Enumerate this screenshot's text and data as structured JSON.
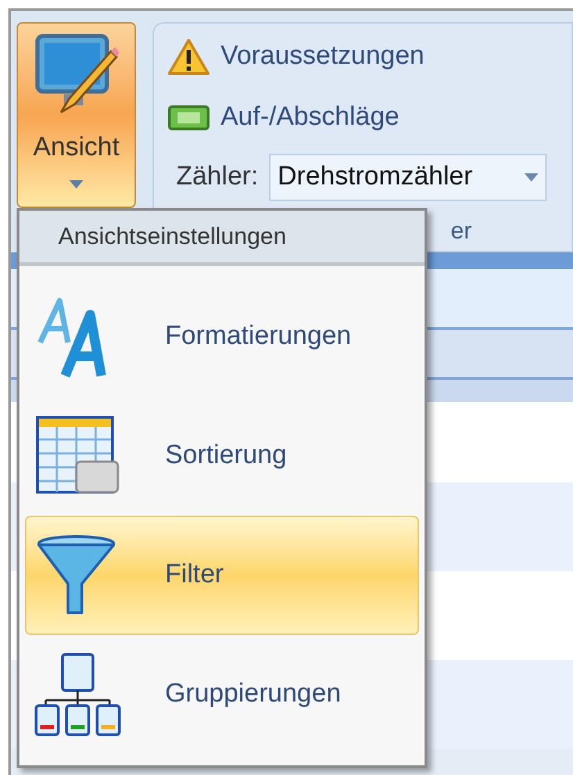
{
  "ribbon": {
    "view_button": {
      "label": "Ansicht",
      "pressed": true
    },
    "items": [
      {
        "kind": "command",
        "label": "Voraussetzungen"
      },
      {
        "kind": "command",
        "label": "Auf-/Abschläge"
      },
      {
        "kind": "combo",
        "label": "Zähler:",
        "value": "Drehstromzähler"
      }
    ],
    "group_label": "er"
  },
  "menu": {
    "header": "Ansichtseinstellungen",
    "items": [
      {
        "label": "Formatierungen",
        "selected": false
      },
      {
        "label": "Sortierung",
        "selected": false
      },
      {
        "label": "Filter",
        "selected": true
      },
      {
        "label": "Gruppierungen",
        "selected": false
      }
    ]
  }
}
